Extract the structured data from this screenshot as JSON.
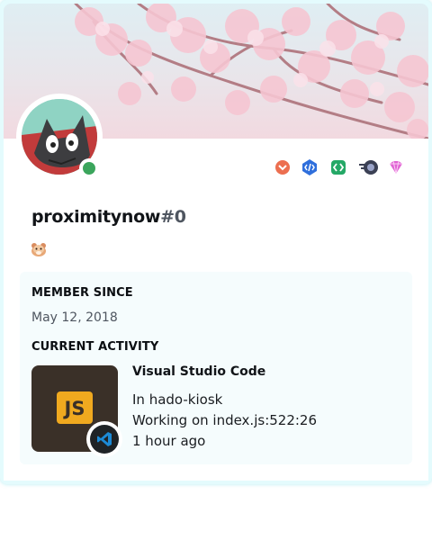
{
  "profile": {
    "username": "proximitynow",
    "discriminator": "#0",
    "status": "online",
    "status_color": "#3ba55c",
    "custom_status_emoji": "hamster-emoji"
  },
  "badges": [
    {
      "icon": "chevron-down-badge-icon",
      "color": "#ec6f50"
    },
    {
      "icon": "code-badge-icon",
      "color": "#2f6fdc"
    },
    {
      "icon": "brackets-badge-icon",
      "color": "#24a866"
    },
    {
      "icon": "orb-badge-icon",
      "color": "#3b4054"
    },
    {
      "icon": "nitro-gem-badge-icon",
      "color": "#e064d4"
    }
  ],
  "member_since": {
    "title": "MEMBER SINCE",
    "value": "May 12, 2018"
  },
  "activity": {
    "title": "CURRENT ACTIVITY",
    "app_name": "Visual Studio Code",
    "large_image_text": "JS",
    "small_image_icon": "vscode-icon",
    "details": "In hado-kiosk",
    "state": "Working on index.js:522:26",
    "elapsed": "1 hour ago"
  },
  "colors": {
    "card_background": "#e4fbfd",
    "js_logo": "#f0a91f",
    "activity_art": "#3a3028"
  }
}
